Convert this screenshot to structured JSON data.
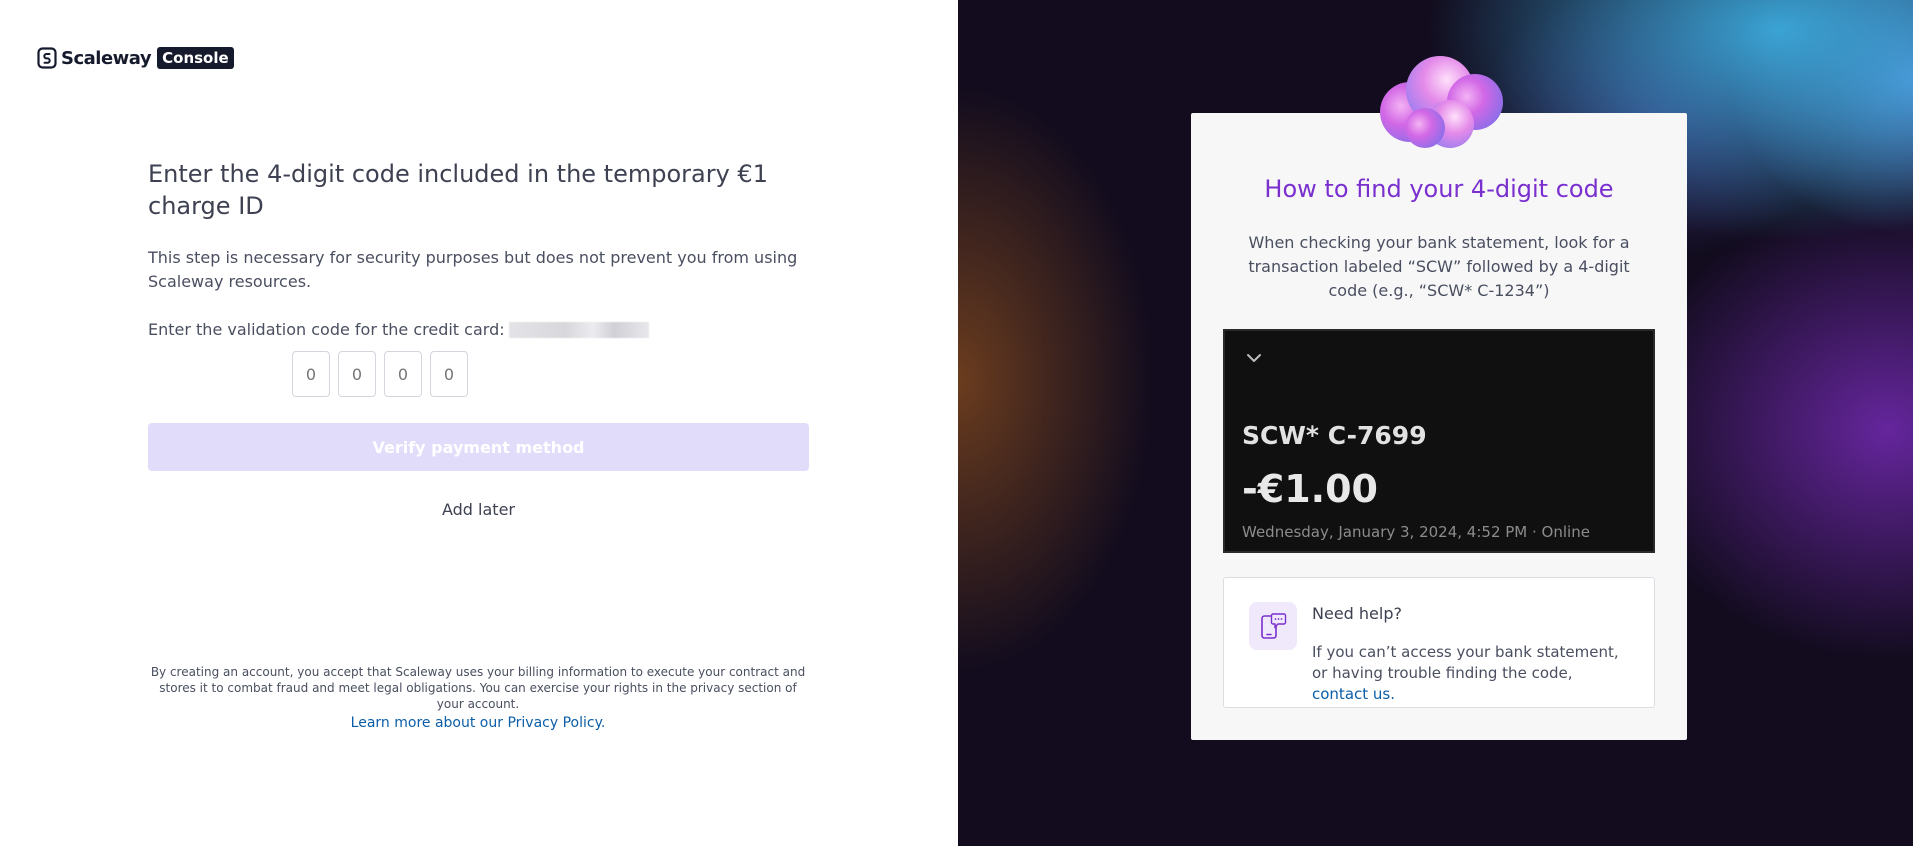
{
  "brand": {
    "name": "Scaleway",
    "badge": "Console"
  },
  "form": {
    "title": "Enter the 4-digit code included in the temporary €1 charge ID",
    "description": "This step is necessary for security purposes but does not prevent you from using Scaleway resources.",
    "card_label": "Enter the validation code for the credit card:",
    "code_placeholders": [
      "0",
      "0",
      "0",
      "0"
    ],
    "verify_label": "Verify payment method",
    "add_later_label": "Add later"
  },
  "legal": {
    "text": "By creating an account, you accept that Scaleway uses your billing information to execute your contract and stores it to combat fraud and meet legal obligations. You can exercise your rights in the privacy section of your account.",
    "link_label": "Learn more about our Privacy Policy."
  },
  "help_panel": {
    "title": "How to find your 4-digit code",
    "description": "When checking your bank statement, look for a transaction labeled “SCW” followed by a 4-digit code (e.g., “SCW* C-1234”)",
    "statement": {
      "label": "SCW* C-7699",
      "amount": "-€1.00",
      "date": "Wednesday, January 3, 2024, 4:52 PM · Online"
    },
    "need_help": {
      "title": "Need help?",
      "text": "If you can’t access your bank statement, or having trouble finding the code,",
      "link_label": "contact us."
    }
  },
  "colors": {
    "accent": "#7a2fcf",
    "verify_disabled_bg": "#e2dcfb",
    "link": "#0b5ea8"
  },
  "icons": {
    "logo": "scaleway-logo-icon",
    "chevron": "chevron-down-icon",
    "help": "phone-chat-icon",
    "decoration": "cloud-illustration"
  }
}
